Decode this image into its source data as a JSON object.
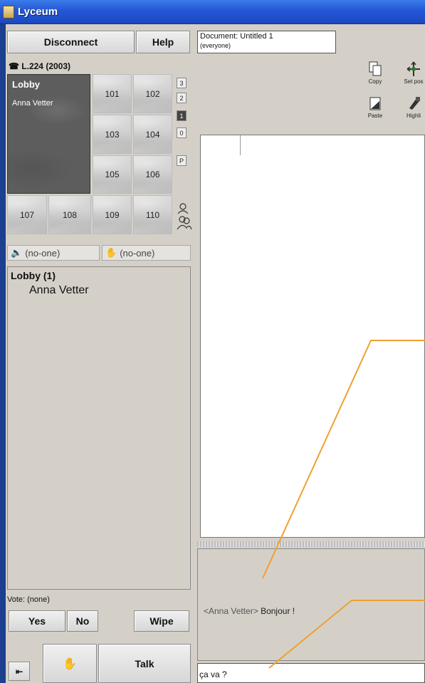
{
  "window": {
    "title": "Lyceum"
  },
  "toolbar": {
    "disconnect_label": "Disconnect",
    "help_label": "Help"
  },
  "building": {
    "label": "L.224 (2003)"
  },
  "lobby": {
    "name": "Lobby",
    "member": "Anna Vetter"
  },
  "rooms": [
    "101",
    "102",
    "103",
    "104",
    "105",
    "106",
    "107",
    "108",
    "109",
    "110"
  ],
  "floors": [
    "3",
    "2",
    "1",
    "0",
    "P"
  ],
  "selected_floor": "1",
  "presence": {
    "speaker": "(no-one)",
    "hand": "(no-one)"
  },
  "roster": {
    "title": "Lobby (1)",
    "members": [
      "Anna Vetter"
    ]
  },
  "vote": {
    "label": "Vote: (none)",
    "yes": "Yes",
    "no": "No",
    "wipe": "Wipe"
  },
  "talk": {
    "label": "Talk"
  },
  "document": {
    "title": "Document: Untitled 1",
    "audience": "(everyone)"
  },
  "doc_tools": [
    {
      "label": "Copy",
      "icon": "copy-icon"
    },
    {
      "label": "Set pos",
      "icon": "set-position-icon"
    },
    {
      "label": "Paste",
      "icon": "paste-icon"
    },
    {
      "label": "Highli",
      "icon": "highlight-icon"
    }
  ],
  "chat": {
    "nick": "<Anna Vetter>",
    "text": "Bonjour !"
  },
  "input": {
    "value": "ça va ?"
  },
  "colors": {
    "titlebar": "#2457d6",
    "annotation": "#f0a030",
    "lobby_bg": "#5d5d5d"
  }
}
